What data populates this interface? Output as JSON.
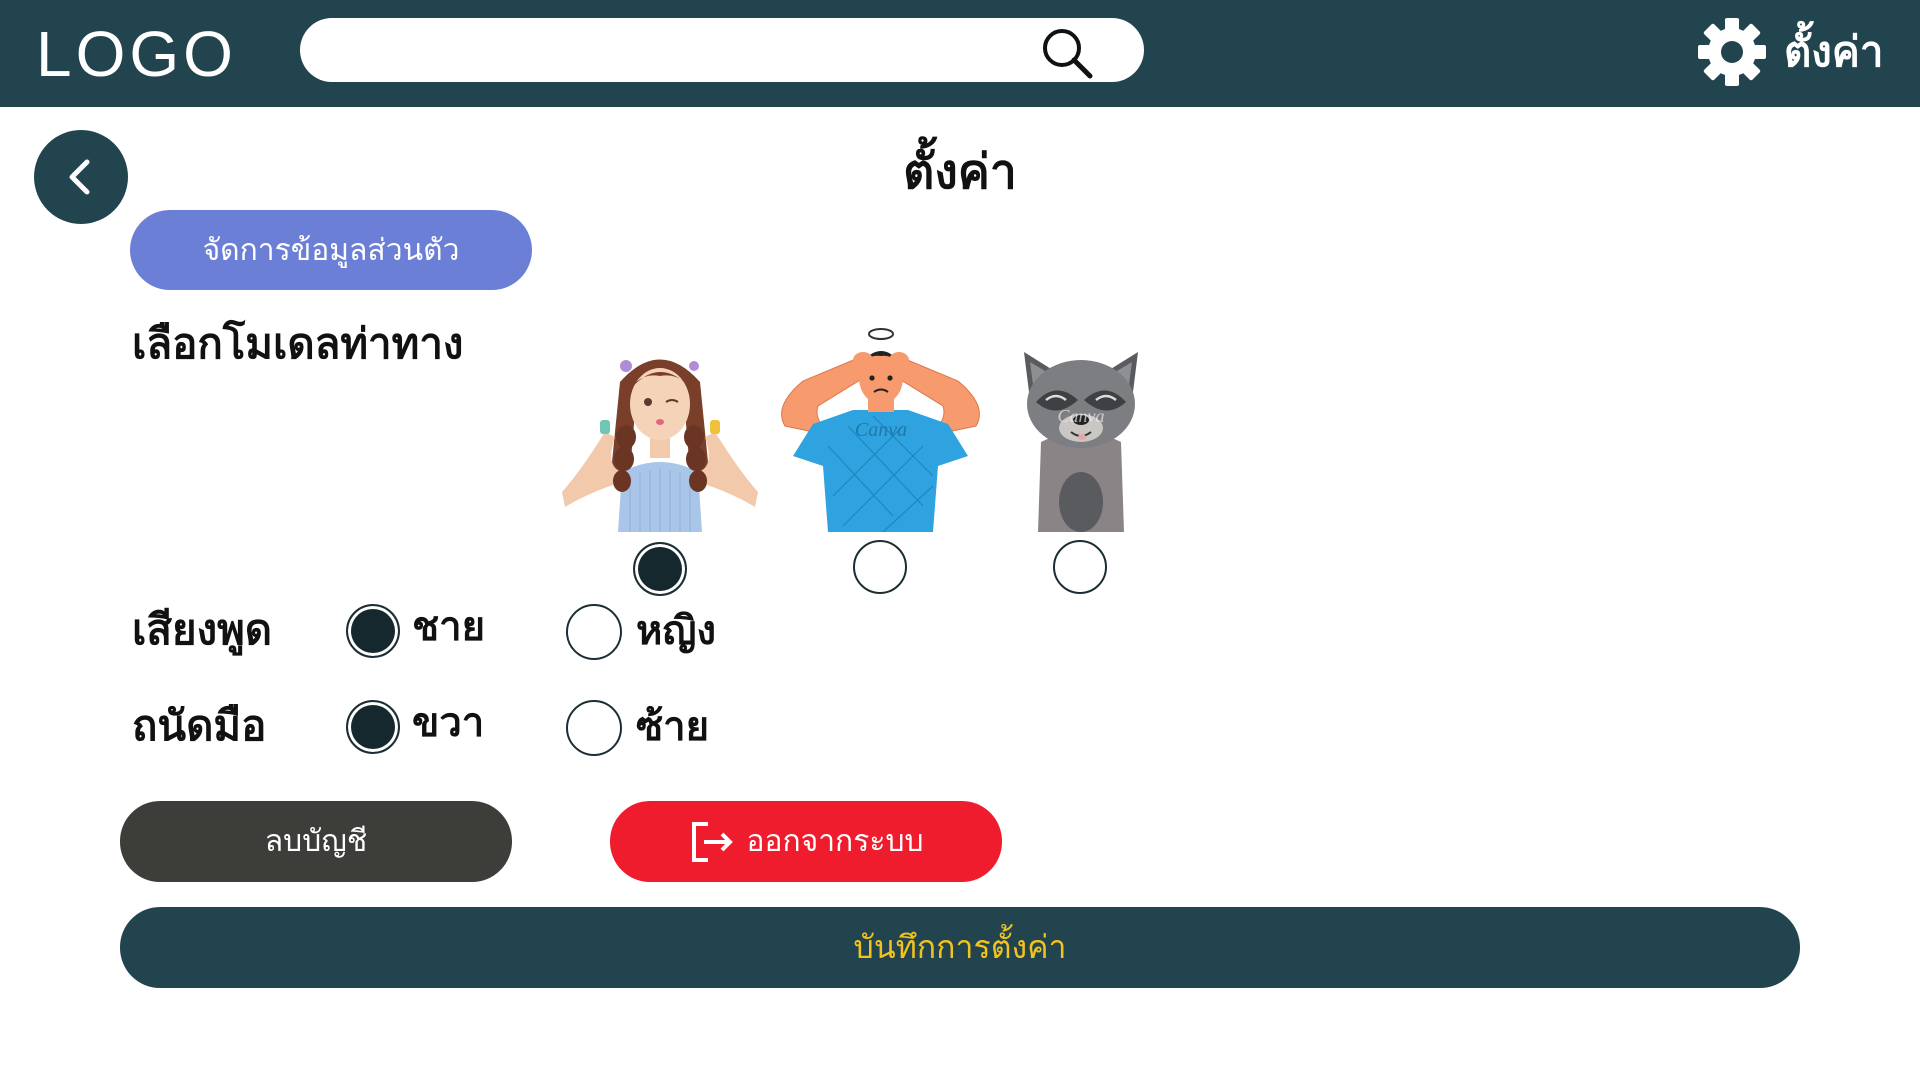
{
  "header": {
    "logo": "LOGO",
    "search": {
      "value": "",
      "placeholder": ""
    },
    "settings_label": "ตั้งค่า"
  },
  "page": {
    "title": "ตั้งค่า"
  },
  "profile_button": "จัดการข้อมูลส่วนตัว",
  "model": {
    "label": "เลือกโมเดลท่าทาง",
    "options": [
      {
        "name": "girl-character",
        "selected": true
      },
      {
        "name": "boy-character",
        "selected": false
      },
      {
        "name": "raccoon-character",
        "selected": false
      }
    ],
    "watermark": "Canva"
  },
  "voice": {
    "label": "เสียงพูด",
    "options": [
      {
        "label": "ชาย",
        "selected": true
      },
      {
        "label": "หญิง",
        "selected": false
      }
    ]
  },
  "hand": {
    "label": "ถนัดมือ",
    "options": [
      {
        "label": "ขวา",
        "selected": true
      },
      {
        "label": "ซ้าย",
        "selected": false
      }
    ]
  },
  "actions": {
    "delete_account": "ลบบัญชี",
    "logout": "ออกจากระบบ",
    "save": "บันทึกการตั้งค่า"
  },
  "colors": {
    "primary": "#22444f",
    "profile_button": "#6b7fd6",
    "delete_button": "#3d3d3a",
    "logout_button": "#ee1c2d",
    "save_text": "#f3c31b"
  }
}
